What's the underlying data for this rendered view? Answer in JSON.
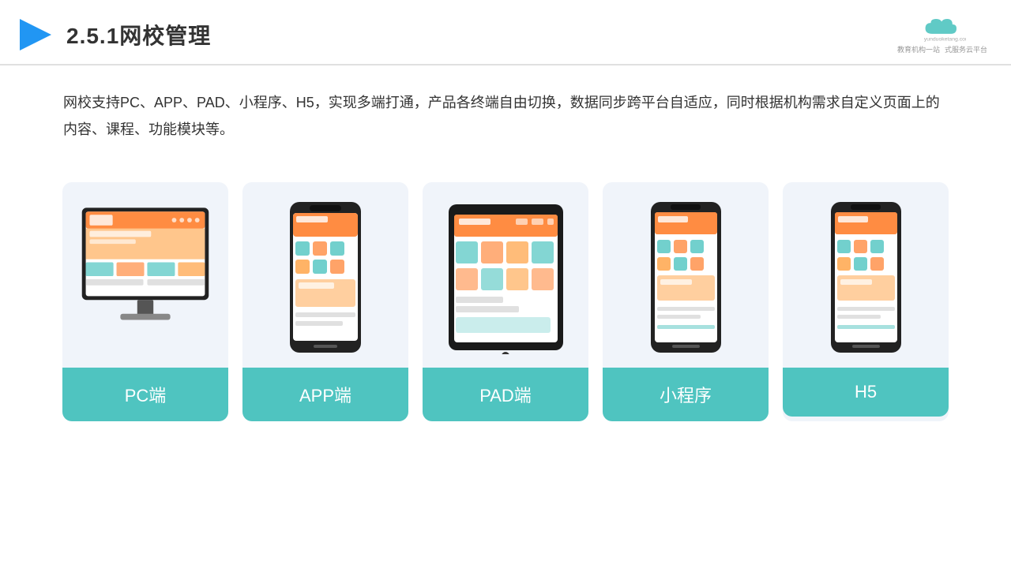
{
  "header": {
    "title": "2.5.1网校管理",
    "logo_url_text": "yunduoketang.com",
    "logo_tagline": "教育机构一站",
    "logo_tagline2": "式服务云平台"
  },
  "description": {
    "text": "网校支持PC、APP、PAD、小程序、H5，实现多端打通，产品各终端自由切换，数据同步跨平台自适应，同时根据机构需求自定义页面上的内容、课程、功能模块等。"
  },
  "cards": [
    {
      "id": "pc",
      "label": "PC端"
    },
    {
      "id": "app",
      "label": "APP端"
    },
    {
      "id": "pad",
      "label": "PAD端"
    },
    {
      "id": "miniprogram",
      "label": "小程序"
    },
    {
      "id": "h5",
      "label": "H5"
    }
  ],
  "accent_color": "#4fc4c0"
}
